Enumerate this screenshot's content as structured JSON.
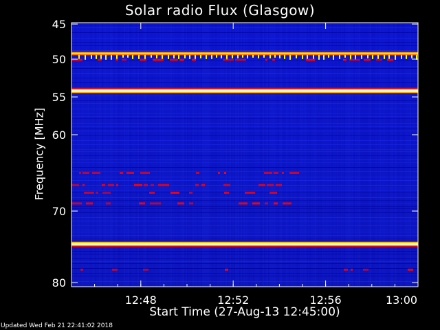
{
  "chart_data": {
    "type": "heatmap",
    "title": "Solar radio Flux (Glasgow)",
    "xlabel": "Start Time (27-Aug-13 12:45:00)",
    "ylabel": "Frequency [MHz]",
    "x_axis": {
      "start": "12:45:00",
      "end": "13:00:00",
      "ticks": [
        "12:48",
        "12:52",
        "12:56",
        "13:00"
      ],
      "tick_minutes": [
        3,
        7,
        11,
        15
      ],
      "range_minutes": [
        0,
        15
      ]
    },
    "y_axis": {
      "range_mhz": [
        80,
        44.5
      ],
      "ticks": [
        45,
        50,
        55,
        60,
        70,
        80
      ],
      "note": "non-linear frequency scale, increasing downward"
    },
    "colormap": [
      "#0000ff",
      "#ff0000",
      "#ffff00",
      "#ffffff"
    ],
    "background_intensity": "low",
    "features": [
      {
        "name": "band",
        "freq_mhz": 49.2,
        "intensity": "high"
      },
      {
        "name": "band",
        "freq_mhz": 50.1,
        "intensity": "medium, intermittent"
      },
      {
        "name": "band",
        "freq_mhz": 54.2,
        "intensity": "very high"
      },
      {
        "name": "band",
        "freq_mhz": 65.0,
        "intensity": "medium, intermittent"
      },
      {
        "name": "band",
        "freq_mhz": 66.6,
        "intensity": "medium, intermittent"
      },
      {
        "name": "band",
        "freq_mhz": 67.6,
        "intensity": "medium, intermittent"
      },
      {
        "name": "band",
        "freq_mhz": 69.0,
        "intensity": "medium, intermittent"
      },
      {
        "name": "band",
        "freq_mhz": 74.6,
        "intensity": "very high"
      },
      {
        "name": "band",
        "freq_mhz": 78.2,
        "intensity": "low-medium, intermittent"
      }
    ],
    "footer": "Updated Wed Feb 21 22:41:02 2018"
  }
}
